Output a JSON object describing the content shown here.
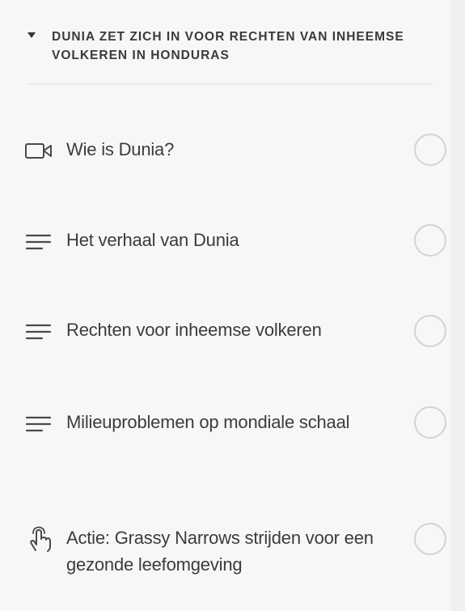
{
  "section": {
    "title": "DUNIA ZET ZICH IN VOOR RECHTEN VAN INHEEMSE VOLKEREN IN HONDURAS",
    "icon": "caret-down-icon"
  },
  "lessons": [
    {
      "label": "Wie is Dunia?",
      "icon": "video-icon",
      "completed": false
    },
    {
      "label": "Het verhaal van Dunia",
      "icon": "text-lines-icon",
      "completed": false
    },
    {
      "label": "Rechten voor inheemse volkeren",
      "icon": "text-lines-icon",
      "completed": false
    },
    {
      "label": "Milieuproblemen op mondiale schaal",
      "icon": "text-lines-icon",
      "completed": false
    },
    {
      "label": "Actie: Grassy Narrows strijden voor een gezonde leefomgeving",
      "icon": "hand-pointer-icon",
      "completed": false
    }
  ]
}
